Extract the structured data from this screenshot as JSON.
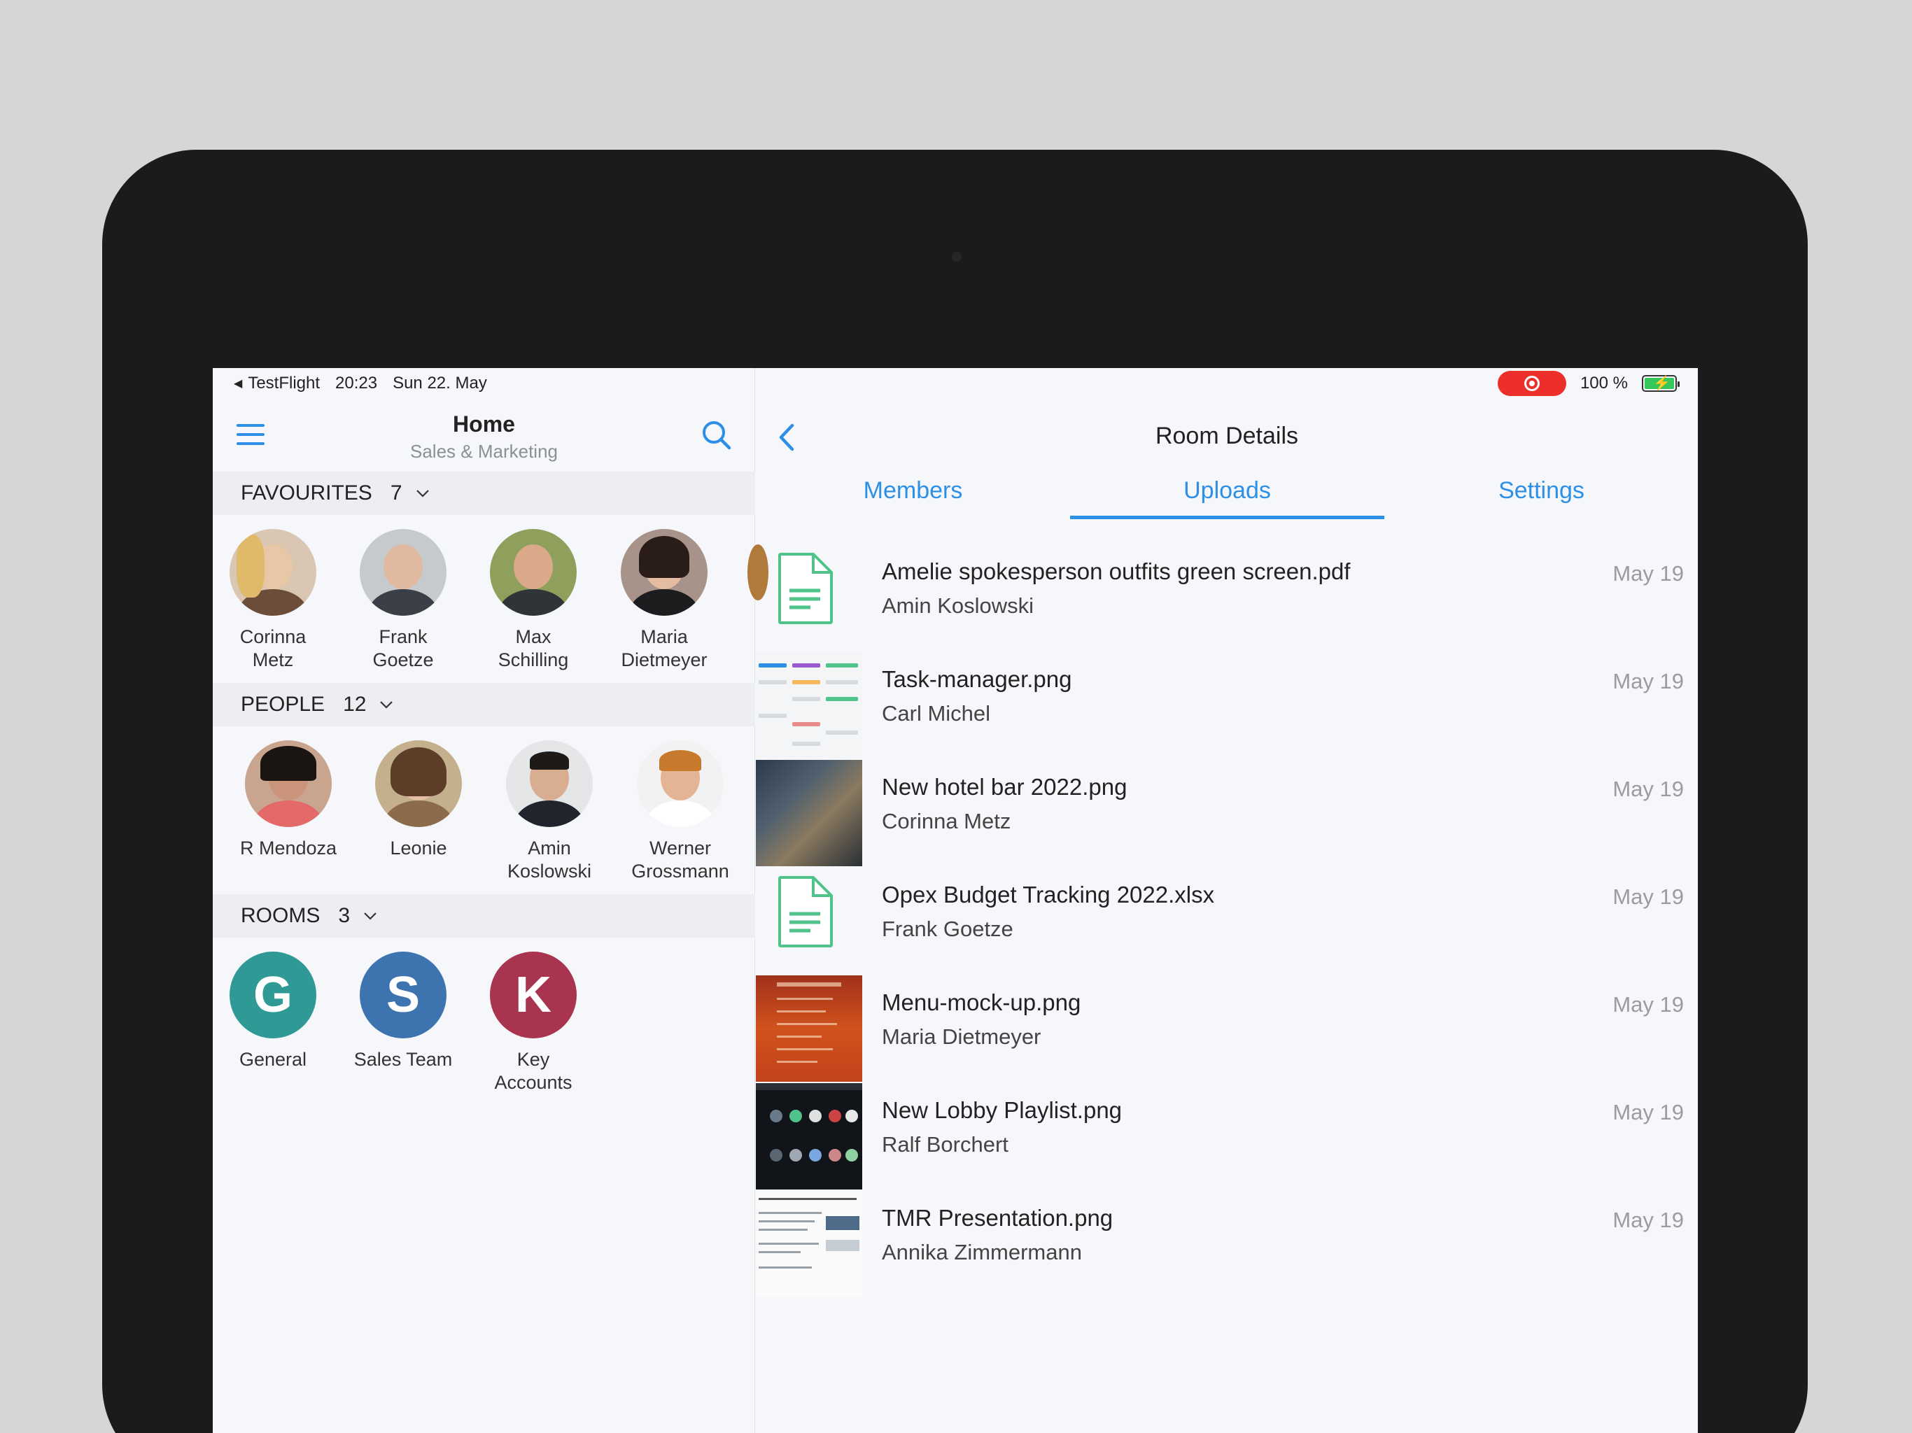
{
  "status": {
    "app": "TestFlight",
    "time": "20:23",
    "date": "Sun 22. May",
    "battery": "100 %"
  },
  "left": {
    "title": "Home",
    "subtitle": "Sales & Marketing",
    "favourites": {
      "label": "FAVOURITES",
      "count": "7",
      "people": [
        {
          "name": "Corinna\nMetz"
        },
        {
          "name": "Frank\nGoetze"
        },
        {
          "name": "Max\nSchilling"
        },
        {
          "name": "Maria\nDietmeyer"
        }
      ]
    },
    "people": {
      "label": "PEOPLE",
      "count": "12",
      "people": [
        {
          "name": "R Mendoza"
        },
        {
          "name": "Leonie"
        },
        {
          "name": "Amin\nKoslowski"
        },
        {
          "name": "Werner\nGrossmann"
        }
      ]
    },
    "rooms": {
      "label": "ROOMS",
      "count": "3",
      "items": [
        {
          "initial": "G",
          "name": "General",
          "color": "#2f9a95"
        },
        {
          "initial": "S",
          "name": "Sales Team",
          "color": "#3d74b0"
        },
        {
          "initial": "K",
          "name": "Key\nAccounts",
          "color": "#a8344f"
        }
      ]
    }
  },
  "right": {
    "title": "Room Details",
    "tabs": [
      "Members",
      "Uploads",
      "Settings"
    ],
    "active_tab": "Uploads",
    "uploads": [
      {
        "name": "Amelie spokesperson outfits green screen.pdf",
        "author": "Amin Koslowski",
        "date": "May 19",
        "thumb": "doc"
      },
      {
        "name": "Task-manager.png",
        "author": "Carl Michel",
        "date": "May 19",
        "thumb": "task"
      },
      {
        "name": "New hotel bar 2022.png",
        "author": "Corinna Metz",
        "date": "May 19",
        "thumb": "bar"
      },
      {
        "name": "Opex Budget Tracking 2022.xlsx",
        "author": "Frank Goetze",
        "date": "May 19",
        "thumb": "doc"
      },
      {
        "name": "Menu-mock-up.png",
        "author": "Maria Dietmeyer",
        "date": "May 19",
        "thumb": "menu"
      },
      {
        "name": "New Lobby Playlist.png",
        "author": "Ralf Borchert",
        "date": "May 19",
        "thumb": "playlist"
      },
      {
        "name": "TMR Presentation.png",
        "author": "Annika Zimmermann",
        "date": "May 19",
        "thumb": "tmr"
      }
    ]
  },
  "colors": {
    "accent": "#2d8fe6",
    "doc_icon": "#4fc38a",
    "record": "#ec2f2b"
  }
}
